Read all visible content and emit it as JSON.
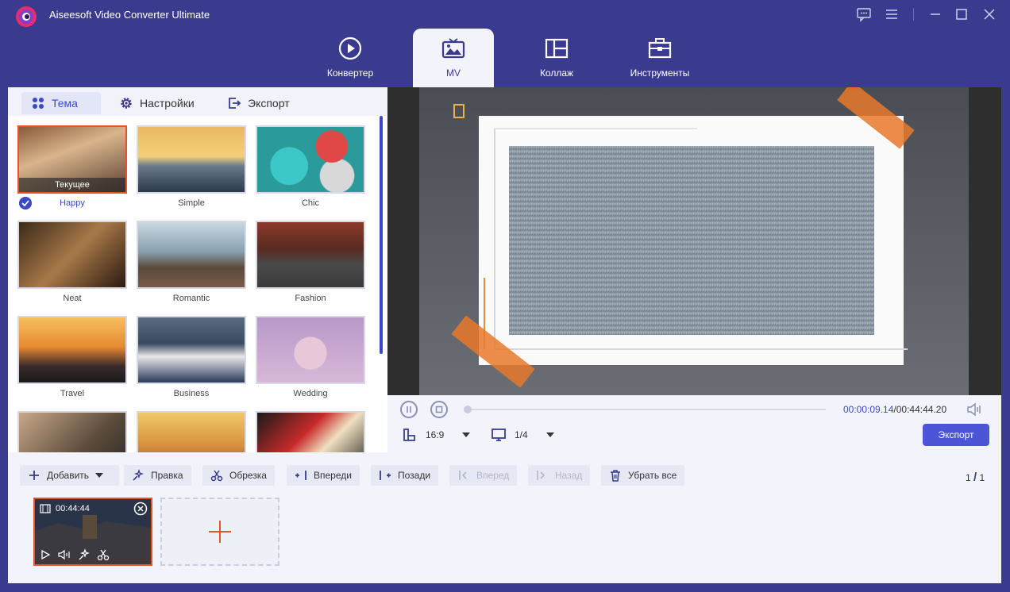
{
  "app": {
    "title": "Aiseesoft Video Converter Ultimate"
  },
  "nav": {
    "tabs": [
      {
        "label": "Конвертер",
        "icon": "converter-icon"
      },
      {
        "label": "MV",
        "icon": "mv-icon",
        "active": true
      },
      {
        "label": "Коллаж",
        "icon": "collage-icon"
      },
      {
        "label": "Инструменты",
        "icon": "toolbox-icon"
      }
    ]
  },
  "subtabs": [
    {
      "label": "Тема",
      "icon": "theme-icon",
      "active": true
    },
    {
      "label": "Настройки",
      "icon": "gear-icon"
    },
    {
      "label": "Экспорт",
      "icon": "export-icon"
    }
  ],
  "themes": [
    {
      "name": "Happy",
      "selected": true,
      "current_label": "Текущее"
    },
    {
      "name": "Simple"
    },
    {
      "name": "Chic"
    },
    {
      "name": "Neat"
    },
    {
      "name": "Romantic"
    },
    {
      "name": "Fashion"
    },
    {
      "name": "Travel"
    },
    {
      "name": "Business"
    },
    {
      "name": "Wedding"
    }
  ],
  "player": {
    "current_time": "00:00:09.14",
    "separator": "/",
    "total_time": "00:44:44.20",
    "aspect_ratio": "16:9",
    "page": "1/4",
    "export_label": "Экспорт"
  },
  "toolbar": {
    "add": "Добавить",
    "edit": "Правка",
    "trim": "Обрезка",
    "ahead": "Впереди",
    "behind": "Позади",
    "forward": "Вперед",
    "backward": "Назад",
    "remove_all": "Убрать все",
    "pager_current": "1",
    "pager_total": "1"
  },
  "clip": {
    "duration": "00:44:44"
  },
  "colors": {
    "accent": "#3b49c8",
    "brand": "#3a3b8f",
    "highlight": "#e2542a"
  }
}
